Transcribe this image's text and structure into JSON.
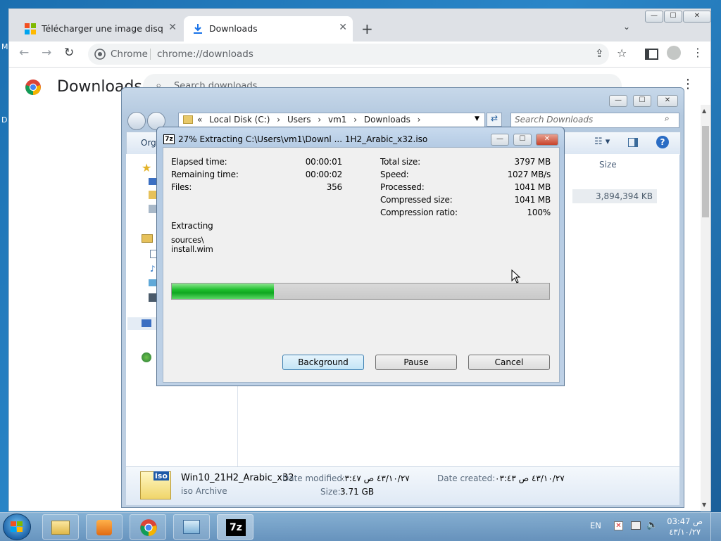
{
  "desktop": {
    "edge_letters": [
      "M",
      "D"
    ]
  },
  "chrome": {
    "tabs": [
      {
        "label": "Télécharger une image disque W"
      },
      {
        "label": "Downloads"
      }
    ],
    "new_tab_symbol": "+",
    "omnibox": {
      "chip": "Chrome",
      "url": "chrome://downloads"
    },
    "downloads_page": {
      "title": "Downloads",
      "search_placeholder": "Search downloads"
    },
    "window_buttons": [
      "—",
      "☐",
      "✕"
    ]
  },
  "explorer": {
    "breadcrumbs": [
      "«",
      "Local Disk (C:)",
      "›",
      "Users",
      "›",
      "vm1",
      "›",
      "Downloads",
      "›"
    ],
    "search_placeholder": "Search Downloads",
    "command_bar": {
      "organize": "Orga"
    },
    "columns": {
      "size": "Size"
    },
    "file_row": {
      "size": "3,894,394 KB"
    },
    "details_pane": {
      "file_name": "Win10_21H2_Arabic_x32",
      "file_type": "iso Archive",
      "date_modified_label": "Date modified:",
      "date_modified_value": "٤٣/١٠/٢٧ ص ٠٣:٤٧",
      "date_created_label": "Date created:",
      "date_created_value": "٤٣/١٠/٢٧ ص ٠٣:٤٣",
      "size_label": "Size:",
      "size_value": "3.71 GB",
      "icon_label": "iso"
    }
  },
  "dialog": {
    "title": "27% Extracting C:\\Users\\vm1\\Downl ... 1H2_Arabic_x32.iso",
    "left_stats": [
      {
        "label": "Elapsed time:",
        "value": "00:00:01"
      },
      {
        "label": "Remaining time:",
        "value": "00:00:02"
      },
      {
        "label": "Files:",
        "value": "356"
      }
    ],
    "right_stats": [
      {
        "label": "Total size:",
        "value": "3797 MB"
      },
      {
        "label": "Speed:",
        "value": "1027 MB/s"
      },
      {
        "label": "Processed:",
        "value": "1041 MB"
      },
      {
        "label": "Compressed size:",
        "value": "1041 MB"
      },
      {
        "label": "Compression ratio:",
        "value": "100%"
      }
    ],
    "status": "Extracting",
    "current_path_line1": "sources\\",
    "current_path_line2": "install.wim",
    "progress_percent": 27,
    "buttons": {
      "background": "Background",
      "pause": "Pause",
      "cancel": "Cancel"
    },
    "app_icon_label": "7z"
  },
  "taskbar": {
    "language": "EN",
    "clock_time": "03:47 ص",
    "clock_date": "٤٣/١٠/٢٧",
    "sevenzip_label": "7z"
  }
}
